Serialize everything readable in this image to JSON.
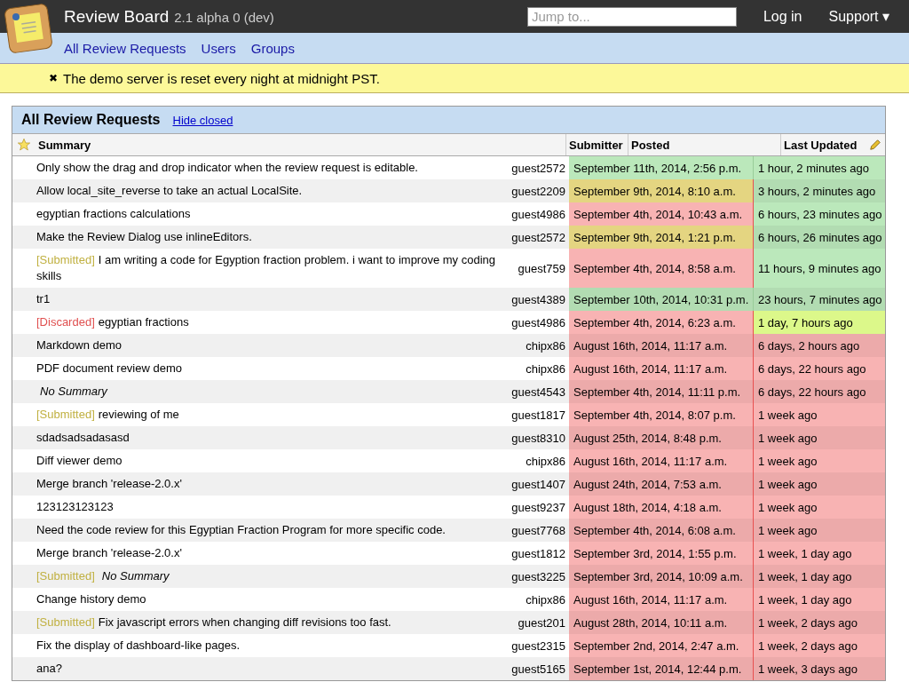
{
  "header": {
    "title": "Review Board",
    "version": "2.1 alpha 0 (dev)",
    "search": {
      "placeholder": "Jump to..."
    },
    "links": [
      "Log in",
      "Support ▾"
    ]
  },
  "nav": [
    "All Review Requests",
    "Users",
    "Groups"
  ],
  "notice": {
    "icon": "✖",
    "text": "The demo server is reset every night at midnight PST."
  },
  "panel": {
    "title": "All Review Requests",
    "link": "Hide closed"
  },
  "columns": [
    "Summary",
    "Submitter",
    "Posted",
    "Last Updated"
  ],
  "rows": [
    {
      "summary": "Only show the drag and drop indicator when the review request is editable.",
      "submitter": "guest2572",
      "posted": {
        "text": "September 11th, 2014, 2:56 p.m.",
        "color": "#bbe8bb"
      },
      "updated": {
        "text": "1 hour, 2 minutes ago",
        "color": "#bbe8bb"
      }
    },
    {
      "summary": "Allow local_site_reverse to take an actual LocalSite.",
      "submitter": "guest2209",
      "posted": {
        "text": "September 9th, 2014, 8:10 a.m.",
        "color": "#f0e088"
      },
      "updated": {
        "text": "3 hours, 2 minutes ago",
        "color": "#bbe8bb"
      }
    },
    {
      "summary": "egyptian fractions calculations",
      "submitter": "guest4986",
      "posted": {
        "text": "September 4th, 2014, 10:43 a.m.",
        "color": "#f8b3b3"
      },
      "updated": {
        "text": "6 hours, 23 minutes ago",
        "color": "#bbe8bb"
      }
    },
    {
      "summary": "Make the Review Dialog use inlineEditors.",
      "submitter": "guest2572",
      "posted": {
        "text": "September 9th, 2014, 1:21 p.m.",
        "color": "#f0e088"
      },
      "updated": {
        "text": "6 hours, 26 minutes ago",
        "color": "#bbe8bb"
      }
    },
    {
      "status": {
        "text": "[Submitted]",
        "kind": "submitted"
      },
      "summary": "I am writing a code for Egyption fraction problem. i want to improve my coding skills",
      "submitter": "guest759",
      "posted": {
        "text": "September 4th, 2014, 8:58 a.m.",
        "color": "#f8b3b3"
      },
      "updated": {
        "text": "11 hours, 9 minutes ago",
        "color": "#bbe8bb"
      }
    },
    {
      "summary": "tr1",
      "submitter": "guest4389",
      "posted": {
        "text": "September 10th, 2014, 10:31 p.m.",
        "color": "#bbe8bb"
      },
      "updated": {
        "text": "23 hours, 7 minutes ago",
        "color": "#bbe8bb"
      }
    },
    {
      "status": {
        "text": "[Discarded]",
        "kind": "discarded"
      },
      "summary": "egyptian fractions",
      "submitter": "guest4986",
      "posted": {
        "text": "September 4th, 2014, 6:23 a.m.",
        "color": "#f8b3b3"
      },
      "updated": {
        "text": "1 day, 7 hours ago",
        "color": "#dcf88a"
      }
    },
    {
      "summary": "Markdown demo",
      "submitter": "chipx86",
      "posted": {
        "text": "August 16th, 2014, 11:17 a.m.",
        "color": "#f8b3b3"
      },
      "updated": {
        "text": "6 days, 2 hours ago",
        "color": "#f8b3b3"
      }
    },
    {
      "summary": "PDF document review demo",
      "submitter": "chipx86",
      "posted": {
        "text": "August 16th, 2014, 11:17 a.m.",
        "color": "#f8b3b3"
      },
      "updated": {
        "text": "6 days, 22 hours ago",
        "color": "#f8b3b3"
      }
    },
    {
      "summary": "No Summary",
      "italic": true,
      "submitter": "guest4543",
      "posted": {
        "text": "September 4th, 2014, 11:11 p.m.",
        "color": "#f8b3b3"
      },
      "updated": {
        "text": "6 days, 22 hours ago",
        "color": "#f8b3b3"
      }
    },
    {
      "status": {
        "text": "[Submitted]",
        "kind": "submitted"
      },
      "summary": "reviewing of me",
      "submitter": "guest1817",
      "posted": {
        "text": "September 4th, 2014, 8:07 p.m.",
        "color": "#f8b3b3"
      },
      "updated": {
        "text": "1 week ago",
        "color": "#f8b3b3"
      }
    },
    {
      "summary": "sdadsadsadasasd",
      "submitter": "guest8310",
      "posted": {
        "text": "August 25th, 2014, 8:48 p.m.",
        "color": "#f8b3b3"
      },
      "updated": {
        "text": "1 week ago",
        "color": "#f8b3b3"
      }
    },
    {
      "summary": "Diff viewer demo",
      "submitter": "chipx86",
      "posted": {
        "text": "August 16th, 2014, 11:17 a.m.",
        "color": "#f8b3b3"
      },
      "updated": {
        "text": "1 week ago",
        "color": "#f8b3b3"
      }
    },
    {
      "summary": "Merge branch 'release-2.0.x'",
      "submitter": "guest1407",
      "posted": {
        "text": "August 24th, 2014, 7:53 a.m.",
        "color": "#f8b3b3"
      },
      "updated": {
        "text": "1 week ago",
        "color": "#f8b3b3"
      }
    },
    {
      "summary": "123123123123",
      "submitter": "guest9237",
      "posted": {
        "text": "August 18th, 2014, 4:18 a.m.",
        "color": "#f8b3b3"
      },
      "updated": {
        "text": "1 week ago",
        "color": "#f8b3b3"
      }
    },
    {
      "summary": "Need the code review for this Egyptian Fraction Program for more specific code.",
      "submitter": "guest7768",
      "posted": {
        "text": "September 4th, 2014, 6:08 a.m.",
        "color": "#f8b3b3"
      },
      "updated": {
        "text": "1 week ago",
        "color": "#f8b3b3"
      }
    },
    {
      "summary": "Merge branch 'release-2.0.x'",
      "submitter": "guest1812",
      "posted": {
        "text": "September 3rd, 2014, 1:55 p.m.",
        "color": "#f8b3b3"
      },
      "updated": {
        "text": "1 week, 1 day ago",
        "color": "#f8b3b3"
      }
    },
    {
      "status": {
        "text": "[Submitted]",
        "kind": "submitted"
      },
      "summary": "No Summary",
      "italic": true,
      "submitter": "guest3225",
      "posted": {
        "text": "September 3rd, 2014, 10:09 a.m.",
        "color": "#f8b3b3"
      },
      "updated": {
        "text": "1 week, 1 day ago",
        "color": "#f8b3b3"
      }
    },
    {
      "summary": "Change history demo",
      "submitter": "chipx86",
      "posted": {
        "text": "August 16th, 2014, 11:17 a.m.",
        "color": "#f8b3b3"
      },
      "updated": {
        "text": "1 week, 1 day ago",
        "color": "#f8b3b3"
      }
    },
    {
      "status": {
        "text": "[Submitted]",
        "kind": "submitted"
      },
      "summary": "Fix javascript errors when changing diff revisions too fast.",
      "submitter": "guest201",
      "posted": {
        "text": "August 28th, 2014, 10:11 a.m.",
        "color": "#f8b3b3"
      },
      "updated": {
        "text": "1 week, 2 days ago",
        "color": "#f8b3b3"
      }
    },
    {
      "summary": "Fix the display of dashboard-like pages.",
      "submitter": "guest2315",
      "posted": {
        "text": "September 2nd, 2014, 2:47 a.m.",
        "color": "#f8b3b3"
      },
      "updated": {
        "text": "1 week, 2 days ago",
        "color": "#f8b3b3"
      }
    },
    {
      "summary": "ana?",
      "submitter": "guest5165",
      "posted": {
        "text": "September 1st, 2014, 12:44 p.m.",
        "color": "#f8b3b3"
      },
      "updated": {
        "text": "1 week, 3 days ago",
        "color": "#f8b3b3"
      }
    }
  ]
}
